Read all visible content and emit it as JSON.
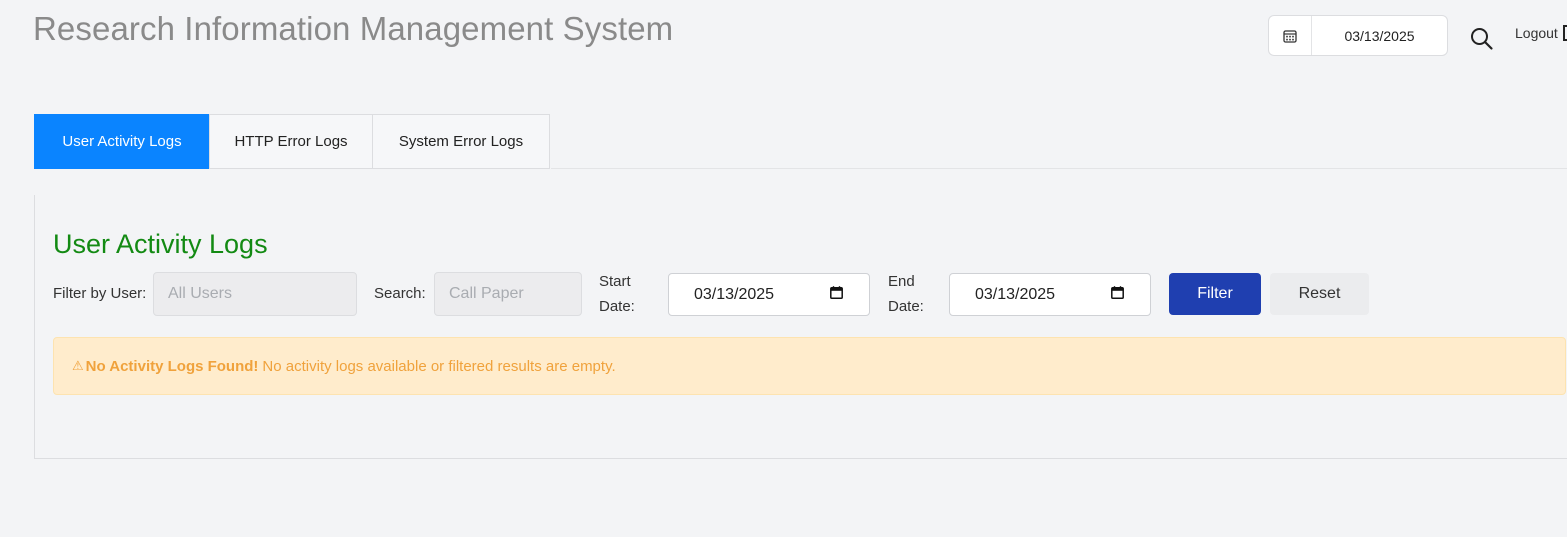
{
  "header": {
    "title": "Research Information Management System",
    "date": "03/13/2025",
    "logout_label": "Logout"
  },
  "tabs": [
    {
      "label": "User Activity Logs",
      "active": true
    },
    {
      "label": "HTTP Error Logs",
      "active": false
    },
    {
      "label": "System Error Logs",
      "active": false
    }
  ],
  "section": {
    "title": "User Activity Logs"
  },
  "filters": {
    "user_label": "Filter by User:",
    "user_placeholder": "All Users",
    "search_label": "Search:",
    "search_placeholder": "Call Paper",
    "start_label_line1": "Start",
    "start_label_line2": "Date:",
    "start_date": "03/13/2025",
    "end_label_line1": "End",
    "end_label_line2": "Date:",
    "end_date": "03/13/2025",
    "filter_button": "Filter",
    "reset_button": "Reset"
  },
  "alert": {
    "icon": "warning-icon",
    "title": "No Activity Logs Found!",
    "message": "No activity logs available or filtered results are empty."
  },
  "colors": {
    "active_tab": "#0a84ff",
    "filter_button": "#1f3fb0",
    "section_title": "#138a13",
    "alert_bg": "#ffeccc",
    "alert_text": "#f0a23c"
  }
}
